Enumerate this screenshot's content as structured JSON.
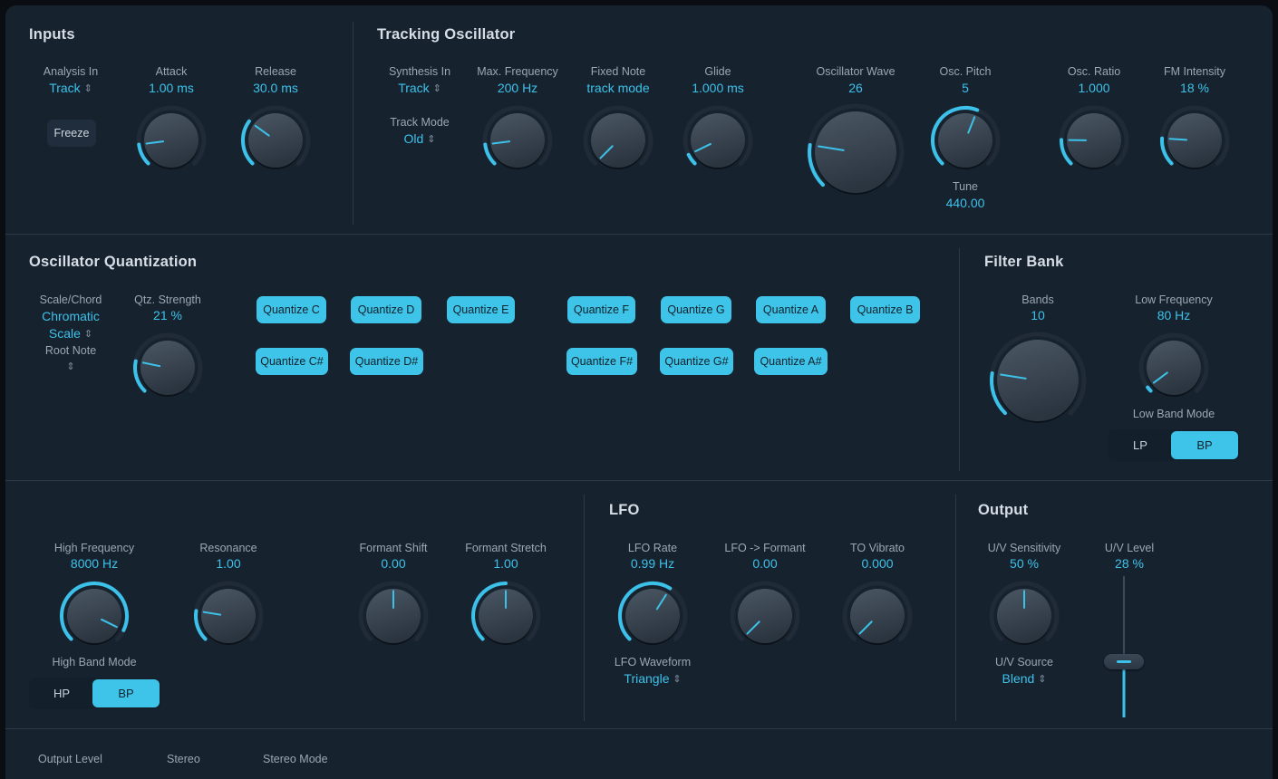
{
  "accent": "#3cc2ea",
  "accent_button": "#3fc4e9",
  "background": "#17222f",
  "sections": {
    "inputs": "Inputs",
    "tracking_oscillator": "Tracking Oscillator",
    "oscillator_quantization": "Oscillator Quantization",
    "filter_bank": "Filter Bank",
    "lfo": "LFO",
    "output": "Output"
  },
  "inputs": {
    "analysis_in": {
      "label": "Analysis In",
      "value": "Track",
      "chevron": "⇕"
    },
    "freeze": {
      "label": "Freeze",
      "active": false
    },
    "attack": {
      "label": "Attack",
      "value": "1.00 ms"
    },
    "release": {
      "label": "Release",
      "value": "30.0 ms"
    }
  },
  "tracking_oscillator": {
    "synthesis_in": {
      "label": "Synthesis In",
      "value": "Track",
      "chevron": "⇕"
    },
    "track_mode": {
      "label": "Track Mode",
      "value": "Old",
      "chevron": "⇕"
    },
    "max_frequency": {
      "label": "Max. Frequency",
      "value": "200 Hz"
    },
    "fixed_note": {
      "label": "Fixed Note",
      "value": "track mode"
    },
    "glide": {
      "label": "Glide",
      "value": "1.000 ms"
    },
    "oscillator_wave": {
      "label": "Oscillator Wave",
      "value": "26"
    },
    "osc_pitch": {
      "label": "Osc. Pitch",
      "value": "5"
    },
    "tune": {
      "label": "Tune",
      "value": "440.00"
    },
    "osc_ratio": {
      "label": "Osc. Ratio",
      "value": "1.000"
    },
    "fm_intensity": {
      "label": "FM Intensity",
      "value": "18 %"
    }
  },
  "oscillator_quantization": {
    "scale_chord": {
      "label": "Scale/Chord",
      "value": "Chromatic Scale",
      "chevron": "⇕"
    },
    "root_note": {
      "label": "Root Note",
      "value": "",
      "chevron": "⇕"
    },
    "qtz_strength": {
      "label": "Qtz. Strength",
      "value": "21 %"
    },
    "quantize_buttons_row1": [
      {
        "label": "Quantize C",
        "active": true
      },
      {
        "label": "Quantize D",
        "active": true
      },
      {
        "label": "Quantize E",
        "active": true
      },
      {
        "label": "Quantize F",
        "active": true
      },
      {
        "label": "Quantize G",
        "active": true
      },
      {
        "label": "Quantize A",
        "active": true
      },
      {
        "label": "Quantize B",
        "active": true
      }
    ],
    "quantize_buttons_row2": [
      {
        "label": "Quantize C#",
        "active": true
      },
      {
        "label": "Quantize D#",
        "active": true
      },
      {
        "label": "Quantize F#",
        "active": true
      },
      {
        "label": "Quantize G#",
        "active": true
      },
      {
        "label": "Quantize A#",
        "active": true
      }
    ]
  },
  "filter_bank": {
    "bands": {
      "label": "Bands",
      "value": "10"
    },
    "low_frequency": {
      "label": "Low Frequency",
      "value": "80 Hz"
    },
    "low_band_mode": {
      "label": "Low Band Mode",
      "options": [
        "LP",
        "BP"
      ],
      "selected": "BP"
    },
    "high_frequency": {
      "label": "High Frequency",
      "value": "8000 Hz"
    },
    "resonance": {
      "label": "Resonance",
      "value": "1.00"
    },
    "high_band_mode": {
      "label": "High Band Mode",
      "options": [
        "HP",
        "BP"
      ],
      "selected": "BP"
    },
    "formant_shift": {
      "label": "Formant Shift",
      "value": "0.00"
    },
    "formant_stretch": {
      "label": "Formant Stretch",
      "value": "1.00"
    }
  },
  "lfo": {
    "lfo_rate": {
      "label": "LFO Rate",
      "value": "0.99 Hz"
    },
    "lfo_formant": {
      "label": "LFO -> Formant",
      "value": "0.00"
    },
    "to_vibrato": {
      "label": "TO Vibrato",
      "value": "0.000"
    },
    "lfo_waveform": {
      "label": "LFO Waveform",
      "value": "Triangle",
      "chevron": "⇕"
    }
  },
  "output": {
    "uv_sensitivity": {
      "label": "U/V Sensitivity",
      "value": "50 %"
    },
    "uv_level": {
      "label": "U/V Level",
      "value": "28 %"
    },
    "uv_source": {
      "label": "U/V Source",
      "value": "Blend",
      "chevron": "⇕"
    }
  },
  "footer": {
    "output_level": "Output Level",
    "stereo": "Stereo",
    "stereo_mode": "Stereo Mode"
  }
}
